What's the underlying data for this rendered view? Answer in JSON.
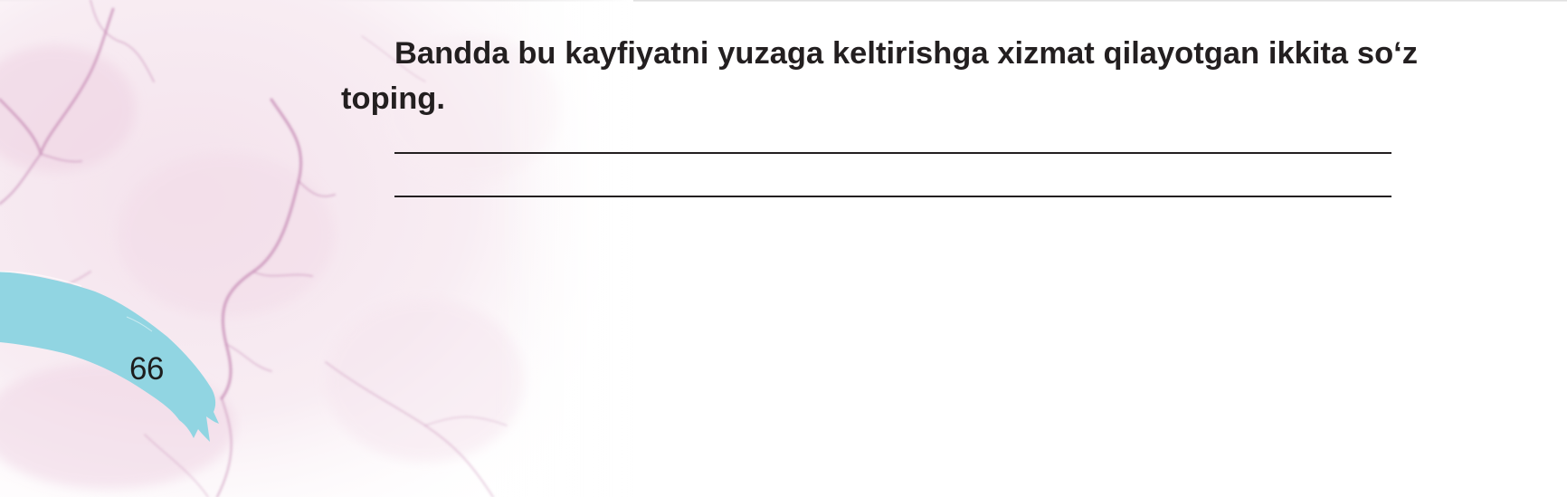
{
  "question": {
    "text": "Bandda bu kayfiyatni yuzaga keltirishga xizmat qilayotgan ikkita so‘z toping."
  },
  "answer_lines": [
    {
      "value": ""
    },
    {
      "value": ""
    }
  ],
  "page": {
    "number": "66"
  },
  "colors": {
    "text": "#231f20",
    "brush_accent": "#91d5e2",
    "marble_vein": "#c99bbf",
    "marble_tint": "#f6e9f0"
  }
}
